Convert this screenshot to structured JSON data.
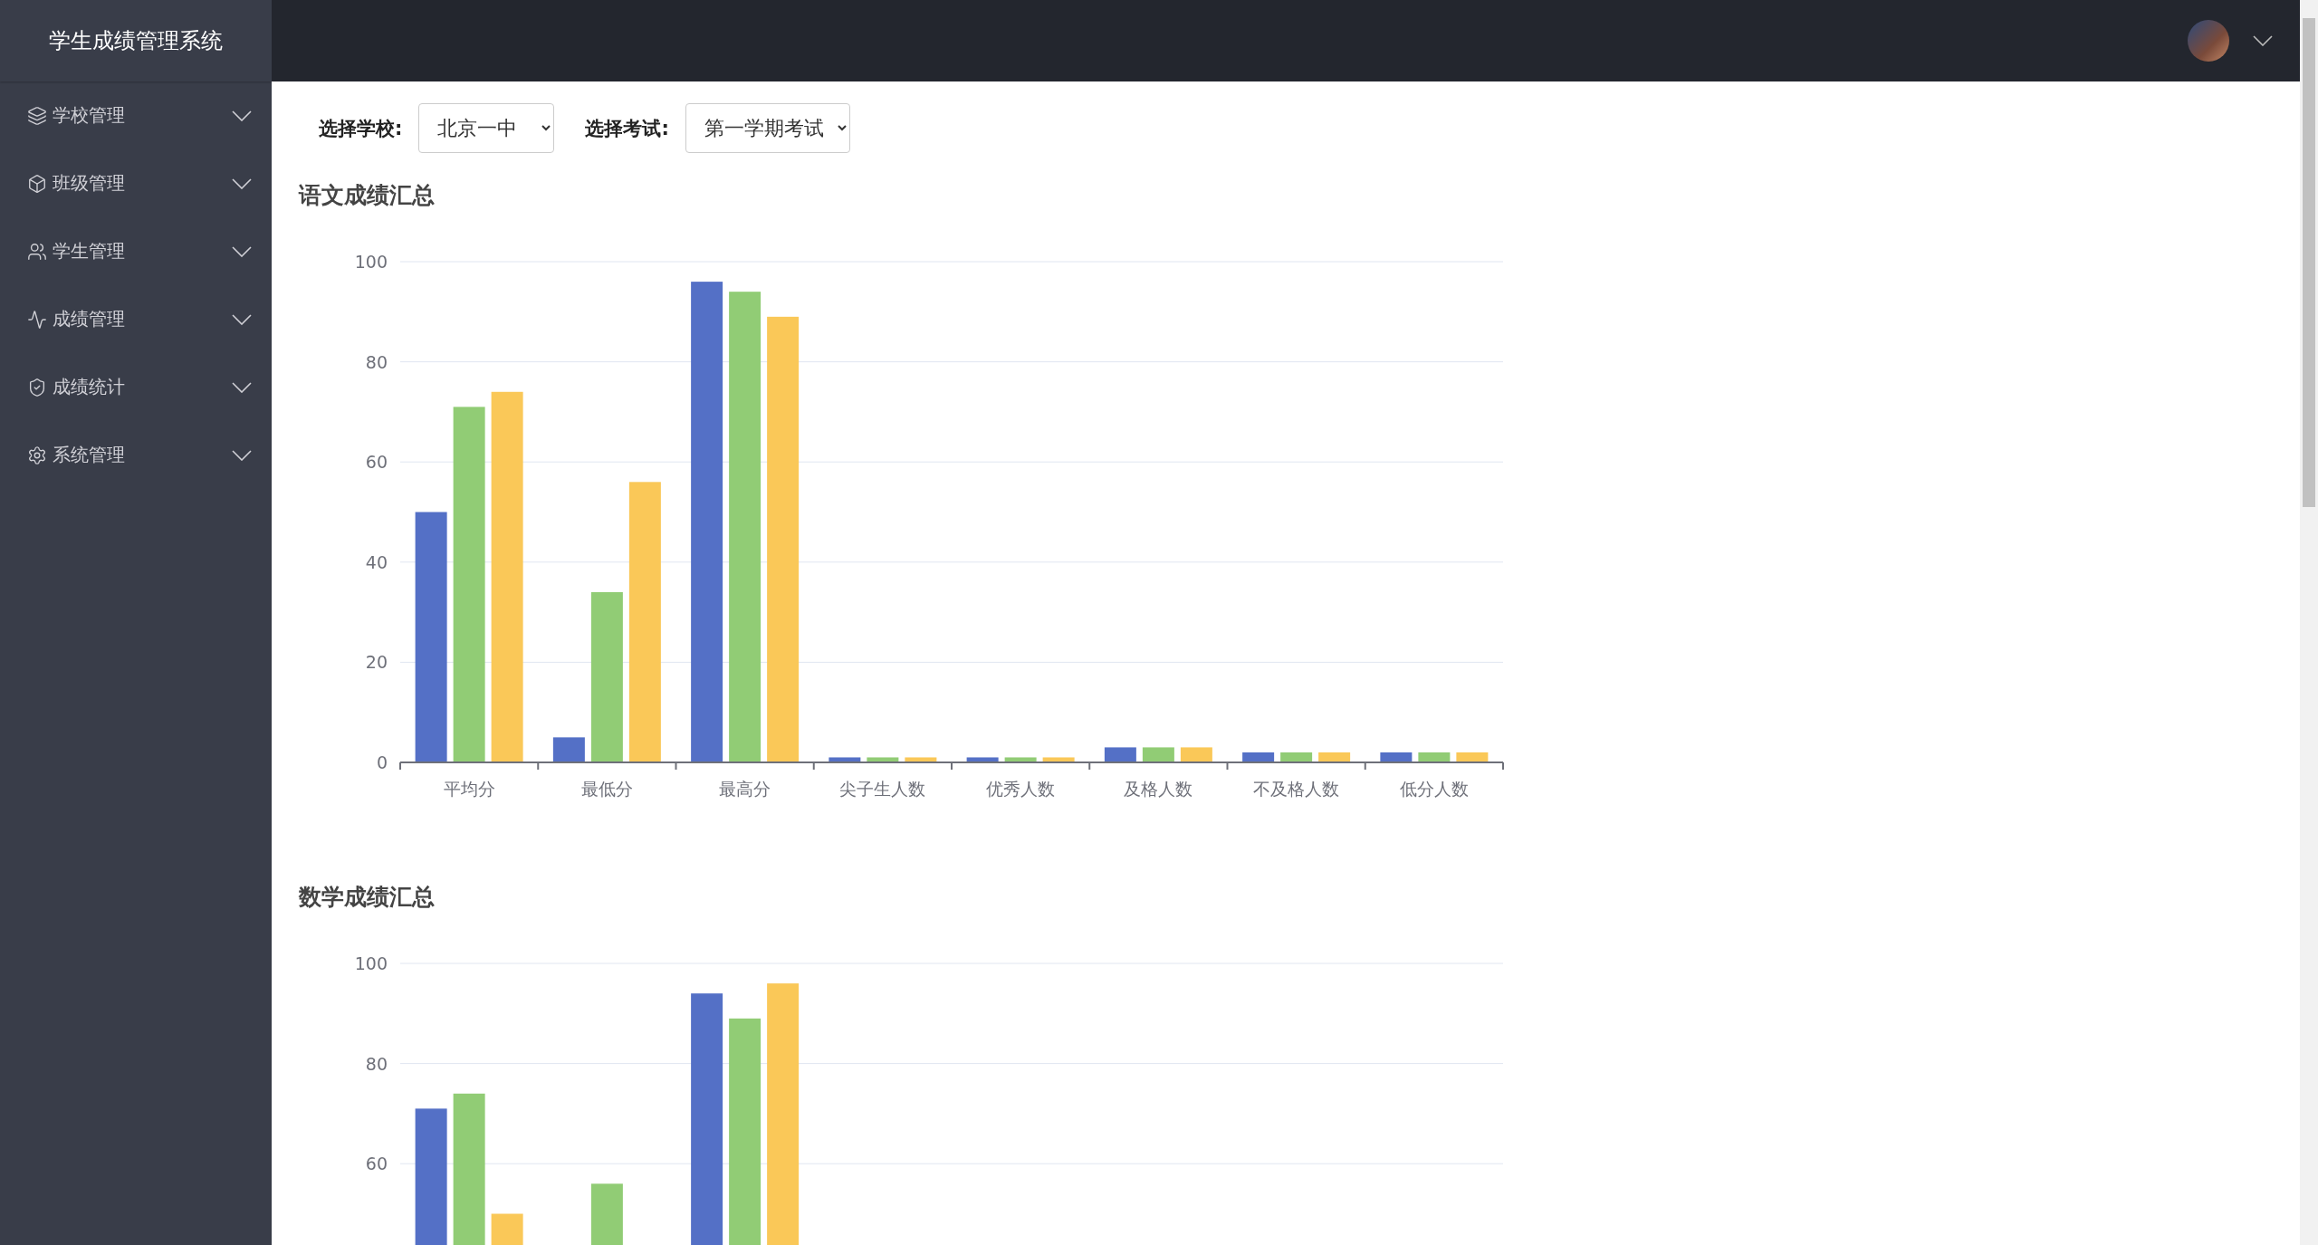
{
  "sidebar": {
    "title": "学生成绩管理系统",
    "items": [
      {
        "kind": "layers",
        "label": "学校管理",
        "expanded": false
      },
      {
        "kind": "box",
        "label": "班级管理",
        "expanded": false
      },
      {
        "kind": "users",
        "label": "学生管理",
        "expanded": false
      },
      {
        "kind": "pulse",
        "label": "成绩管理",
        "expanded": false
      },
      {
        "kind": "shield",
        "label": "成绩统计",
        "expanded": false
      },
      {
        "kind": "gear",
        "label": "系统管理",
        "expanded": false
      }
    ]
  },
  "filters": [
    {
      "label": "选择学校:",
      "value": "北京一中"
    },
    {
      "label": "选择考试:",
      "value": "第一学期考试"
    }
  ],
  "sections": [
    {
      "title": "语文成绩汇总",
      "chart_data": {
        "type": "bar",
        "grid": true,
        "categories": [
          "平均分",
          "最低分",
          "最高分",
          "尖子生人数",
          "优秀人数",
          "及格人数",
          "不及格人数",
          "低分人数"
        ],
        "ylim": [
          0,
          100
        ],
        "yticks": [
          0,
          20,
          40,
          60,
          80,
          100
        ],
        "series": [
          {
            "color": "#5470c6",
            "values": [
              50,
              5,
              96,
              1,
              1,
              3,
              2,
              2
            ]
          },
          {
            "color": "#91cc75",
            "values": [
              71,
              34,
              94,
              1,
              1,
              3,
              2,
              2
            ]
          },
          {
            "color": "#fac858",
            "values": [
              74,
              56,
              89,
              1,
              1,
              3,
              2,
              2
            ]
          }
        ]
      }
    },
    {
      "title": "数学成绩汇总",
      "chart_data": {
        "type": "bar",
        "grid": true,
        "ylim": [
          0,
          100
        ],
        "yticks": [
          60,
          80,
          100
        ],
        "series": [
          {
            "color": "#5470c6",
            "values": [
              71,
              null,
              94,
              null,
              null,
              null,
              null,
              null
            ]
          },
          {
            "color": "#91cc75",
            "values": [
              74,
              56,
              89,
              null,
              null,
              null,
              null,
              null
            ]
          },
          {
            "color": "#fac858",
            "values": [
              50,
              null,
              96,
              null,
              null,
              null,
              null,
              null
            ]
          }
        ]
      }
    }
  ]
}
